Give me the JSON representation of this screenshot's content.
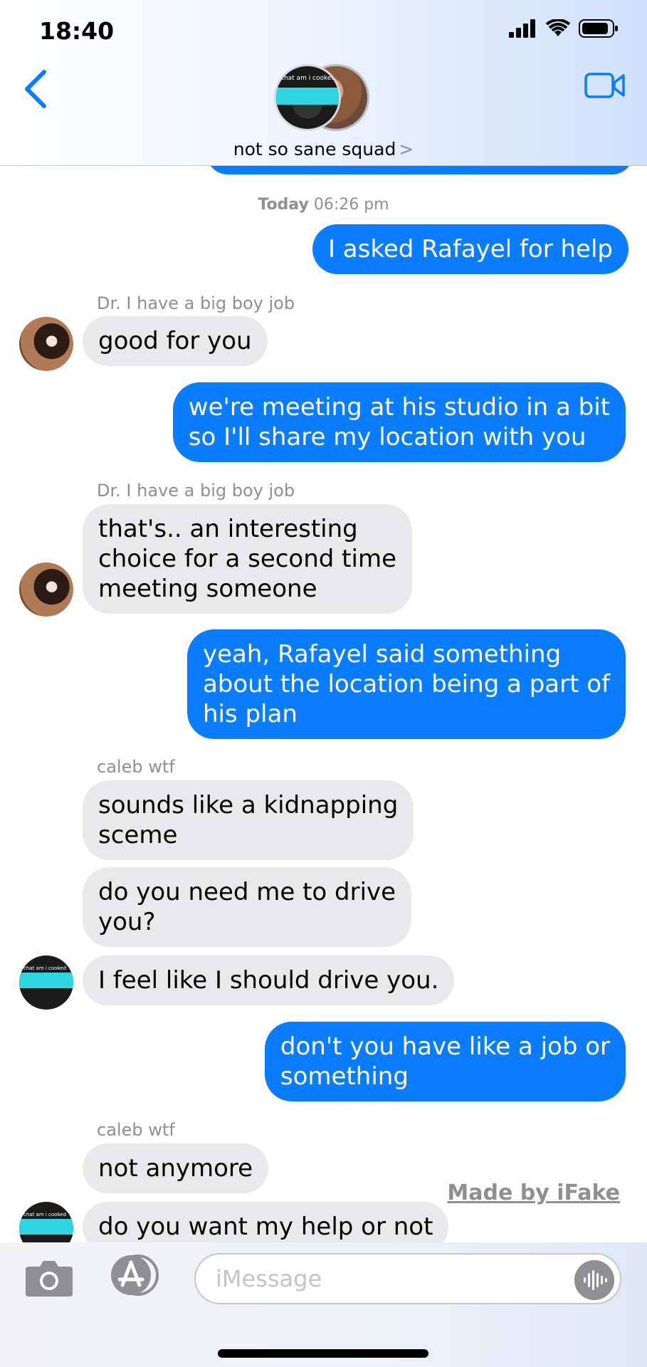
{
  "status_bar": {
    "time": "18:40"
  },
  "header": {
    "group_name": "not so sane squad",
    "chevron": ">",
    "avatar_caption": "chat am i cooked"
  },
  "timestamp": {
    "day": "Today",
    "time": "06:26 pm"
  },
  "messages": [
    {
      "type": "out",
      "text": "I asked Rafayel for help"
    },
    {
      "type": "sender",
      "text": "Dr. I have a big boy job"
    },
    {
      "type": "in",
      "text": "good for you"
    },
    {
      "type": "out",
      "text": "we're meeting at his studio in a bit\nso I'll share my location with you"
    },
    {
      "type": "sender",
      "text": "Dr. I have a big boy job"
    },
    {
      "type": "in",
      "text": "that's.. an interesting\nchoice for a second time\nmeeting someone"
    },
    {
      "type": "out",
      "text": "yeah, Rafayel said something\nabout the location being a part of\nhis plan"
    },
    {
      "type": "sender",
      "text": "caleb wtf"
    },
    {
      "type": "in",
      "text": "sounds like a kidnapping\nsceme"
    },
    {
      "type": "in",
      "text": "do you need me to drive\nyou?"
    },
    {
      "type": "in",
      "text": "I feel like I should drive you."
    },
    {
      "type": "out",
      "text": "don't you have like a job or\nsomething"
    },
    {
      "type": "sender",
      "text": "caleb wtf"
    },
    {
      "type": "in",
      "text": "not anymore"
    },
    {
      "type": "in",
      "text": "do you want my help or not"
    }
  ],
  "avatar_caption_small": "chat am i cooked",
  "watermark": "Made by iFake",
  "input": {
    "placeholder": "iMessage"
  },
  "colors": {
    "outgoing_bubble": "#0a7cff",
    "incoming_bubble": "#e9e9eb",
    "accent": "#0a7cff"
  },
  "icons": [
    "back-chevron-icon",
    "video-call-icon",
    "camera-icon",
    "app-store-icon",
    "audio-waveform-icon",
    "signal-icon",
    "wifi-icon",
    "battery-icon"
  ]
}
